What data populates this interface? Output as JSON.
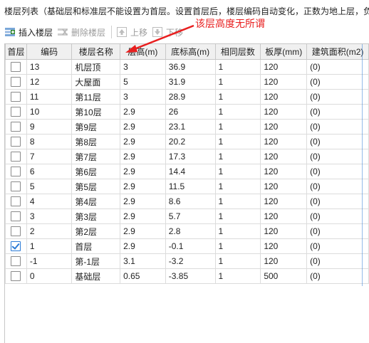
{
  "title": "楼层列表（基础层和标准层不能设置为首层。设置首层后，楼层编码自动变化，正数为地上层，负",
  "toolbar": {
    "insert_label": "插入楼层",
    "delete_label": "删除楼层",
    "up_label": "上移",
    "down_label": "下移"
  },
  "annotation": "该层高度无所谓",
  "columns": [
    "首层",
    "编码",
    "楼层名称",
    "层高(m)",
    "底标高(m)",
    "相同层数",
    "板厚(mm)",
    "建筑面积(m2)"
  ],
  "rows": [
    {
      "first": false,
      "code": "13",
      "name": "机层顶",
      "height": "3",
      "base": "36.9",
      "same": "1",
      "slab": "120",
      "area": "(0)"
    },
    {
      "first": false,
      "code": "12",
      "name": "大屋面",
      "height": "5",
      "base": "31.9",
      "same": "1",
      "slab": "120",
      "area": "(0)"
    },
    {
      "first": false,
      "code": "11",
      "name": "第11层",
      "height": "3",
      "base": "28.9",
      "same": "1",
      "slab": "120",
      "area": "(0)"
    },
    {
      "first": false,
      "code": "10",
      "name": "第10层",
      "height": "2.9",
      "base": "26",
      "same": "1",
      "slab": "120",
      "area": "(0)"
    },
    {
      "first": false,
      "code": "9",
      "name": "第9层",
      "height": "2.9",
      "base": "23.1",
      "same": "1",
      "slab": "120",
      "area": "(0)"
    },
    {
      "first": false,
      "code": "8",
      "name": "第8层",
      "height": "2.9",
      "base": "20.2",
      "same": "1",
      "slab": "120",
      "area": "(0)"
    },
    {
      "first": false,
      "code": "7",
      "name": "第7层",
      "height": "2.9",
      "base": "17.3",
      "same": "1",
      "slab": "120",
      "area": "(0)"
    },
    {
      "first": false,
      "code": "6",
      "name": "第6层",
      "height": "2.9",
      "base": "14.4",
      "same": "1",
      "slab": "120",
      "area": "(0)"
    },
    {
      "first": false,
      "code": "5",
      "name": "第5层",
      "height": "2.9",
      "base": "11.5",
      "same": "1",
      "slab": "120",
      "area": "(0)"
    },
    {
      "first": false,
      "code": "4",
      "name": "第4层",
      "height": "2.9",
      "base": "8.6",
      "same": "1",
      "slab": "120",
      "area": "(0)"
    },
    {
      "first": false,
      "code": "3",
      "name": "第3层",
      "height": "2.9",
      "base": "5.7",
      "same": "1",
      "slab": "120",
      "area": "(0)"
    },
    {
      "first": false,
      "code": "2",
      "name": "第2层",
      "height": "2.9",
      "base": "2.8",
      "same": "1",
      "slab": "120",
      "area": "(0)"
    },
    {
      "first": true,
      "code": "1",
      "name": "首层",
      "height": "2.9",
      "base": "-0.1",
      "same": "1",
      "slab": "120",
      "area": "(0)"
    },
    {
      "first": false,
      "code": "-1",
      "name": "第-1层",
      "height": "3.1",
      "base": "-3.2",
      "same": "1",
      "slab": "120",
      "area": "(0)"
    },
    {
      "first": false,
      "code": "0",
      "name": "基础层",
      "height": "0.65",
      "base": "-3.85",
      "same": "1",
      "slab": "500",
      "area": "(0)"
    }
  ]
}
